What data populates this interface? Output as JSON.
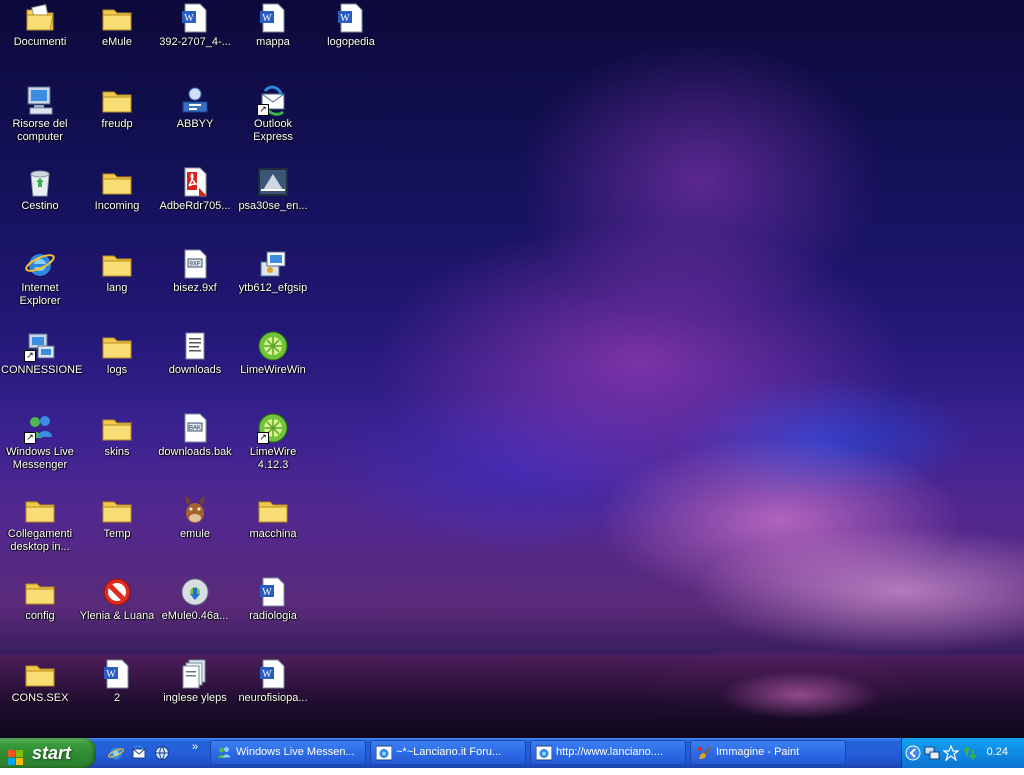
{
  "desktop": {
    "icons": [
      {
        "label": "Documenti",
        "icon": "folder-documents-icon"
      },
      {
        "label": "Risorse del computer",
        "icon": "computer-icon"
      },
      {
        "label": "Cestino",
        "icon": "recycle-bin-icon"
      },
      {
        "label": "Internet Explorer",
        "icon": "internet-explorer-icon"
      },
      {
        "label": "CONNESSIONE",
        "icon": "network-connection-icon"
      },
      {
        "label": "Windows Live Messenger",
        "icon": "messenger-icon"
      },
      {
        "label": "Collegamenti desktop in...",
        "icon": "folder-icon"
      },
      {
        "label": "config",
        "icon": "folder-icon"
      },
      {
        "label": "CONS.SEX",
        "icon": "folder-icon"
      },
      {
        "label": "eMule",
        "icon": "folder-icon"
      },
      {
        "label": "freudp",
        "icon": "folder-icon"
      },
      {
        "label": "Incoming",
        "icon": "folder-icon"
      },
      {
        "label": "lang",
        "icon": "folder-icon"
      },
      {
        "label": "logs",
        "icon": "folder-icon"
      },
      {
        "label": "skins",
        "icon": "folder-icon"
      },
      {
        "label": "Temp",
        "icon": "folder-icon"
      },
      {
        "label": "Ylenia & Luana",
        "icon": "no-entry-icon"
      },
      {
        "label": "2",
        "icon": "word-document-icon"
      },
      {
        "label": "392-2707_4-...",
        "icon": "word-document-icon"
      },
      {
        "label": "ABBYY",
        "icon": "abbyy-icon"
      },
      {
        "label": "AdbeRdr705...",
        "icon": "adobe-reader-installer-icon"
      },
      {
        "label": "bisez.9xf",
        "icon": "text-file-icon"
      },
      {
        "label": "downloads",
        "icon": "notepad-file-icon"
      },
      {
        "label": "downloads.bak",
        "icon": "text-file-icon"
      },
      {
        "label": "emule",
        "icon": "emule-mule-icon"
      },
      {
        "label": "eMule0.46a...",
        "icon": "installer-disc-icon"
      },
      {
        "label": "inglese yleps",
        "icon": "document-stack-icon"
      },
      {
        "label": "mappa",
        "icon": "word-document-icon"
      },
      {
        "label": "Outlook Express",
        "icon": "outlook-express-icon"
      },
      {
        "label": "psa30se_en...",
        "icon": "installer-icon"
      },
      {
        "label": "ytb612_efgsip",
        "icon": "setup-icon"
      },
      {
        "label": "LimeWireWin",
        "icon": "limewire-icon"
      },
      {
        "label": "LimeWire 4.12.3",
        "icon": "limewire-icon"
      },
      {
        "label": "macchina",
        "icon": "folder-icon"
      },
      {
        "label": "radiologia",
        "icon": "word-document-icon"
      },
      {
        "label": "neurofisiopa...",
        "icon": "word-document-icon"
      },
      {
        "label": "logopedia",
        "icon": "word-document-icon"
      }
    ]
  },
  "taskbar": {
    "start_label": "start",
    "quick_launch": [
      "internet-explorer-icon",
      "outlook-express-icon",
      "browser-icon"
    ],
    "more_label": "»",
    "tasks": [
      {
        "label": "Windows Live Messen...",
        "icon": "messenger-icon"
      },
      {
        "label": "~*~Lanciano.it Foru...",
        "icon": "internet-explorer-icon"
      },
      {
        "label": "http://www.lanciano....",
        "icon": "internet-explorer-icon"
      },
      {
        "label": "Immagine - Paint",
        "icon": "paint-icon"
      }
    ],
    "tray": {
      "icons": [
        "chevron-left-icon",
        "network-icon",
        "star-icon",
        "transfer-icon"
      ],
      "clock": "0.24"
    }
  },
  "colors": {
    "taskbar_blue": "#245edb",
    "start_green": "#3a9b3c",
    "tray_blue": "#0f8ae2",
    "folder_yellow": "#f5d25c"
  }
}
